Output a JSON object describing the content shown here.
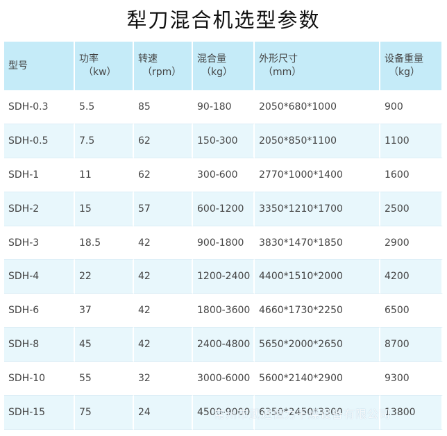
{
  "title": "犁刀混合机选型参数",
  "table": {
    "headers": [
      {
        "label": "型号",
        "unit": ""
      },
      {
        "label": "功率",
        "unit": "（kw）"
      },
      {
        "label": "转速",
        "unit": "（rpm）"
      },
      {
        "label": "混合量",
        "unit": "（kg）"
      },
      {
        "label": "外形尺寸",
        "unit": "（mm）"
      },
      {
        "label": "设备重量",
        "unit": "（kg）"
      }
    ],
    "rows": [
      [
        "SDH-0.3",
        "5.5",
        "85",
        "90-180",
        "2050*680*1000",
        "900"
      ],
      [
        "SDH-0.5",
        "7.5",
        "62",
        "150-300",
        "2050*850*1100",
        "1100"
      ],
      [
        "SDH-1",
        "11",
        "62",
        "300-600",
        "2770*1000*1400",
        "1600"
      ],
      [
        "SDH-2",
        "15",
        "57",
        "600-1200",
        "3350*1210*1700",
        "2500"
      ],
      [
        "SDH-3",
        "18.5",
        "42",
        "900-1800",
        "3830*1470*1850",
        "2900"
      ],
      [
        "SDH-4",
        "22",
        "42",
        "1200-2400",
        "4400*1510*2000",
        "4200"
      ],
      [
        "SDH-6",
        "37",
        "42",
        "1800-3600",
        "4660*1730*2250",
        "6500"
      ],
      [
        "SDH-8",
        "45",
        "42",
        "2400-4800",
        "5650*2000*2650",
        "8700"
      ],
      [
        "SDH-10",
        "55",
        "32",
        "3000-6000",
        "5600*2140*2900",
        "9300"
      ],
      [
        "SDH-15",
        "75",
        "24",
        "4500-9000",
        "6350*2450*3300",
        "13800"
      ]
    ]
  },
  "watermark": "常州市武进恒力干燥设备有限公司"
}
